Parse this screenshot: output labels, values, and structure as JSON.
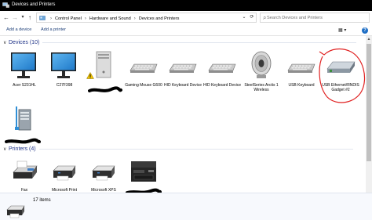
{
  "window": {
    "title": "Devices and Printers"
  },
  "address": {
    "crumbs": [
      "Control Panel",
      "Hardware and Sound",
      "Devices and Printers"
    ],
    "back_glyph": "←",
    "forward_glyph": "→",
    "recent_glyph": "▾",
    "up_glyph": "↑",
    "dropdown_glyph": "⌄",
    "refresh_glyph": "⟳",
    "search_placeholder": "Search Devices and Printers",
    "search_glyph": "⌕"
  },
  "commands": {
    "add_device": "Add a device",
    "add_printer": "Add a printer",
    "view_glyph": "▦ ▾",
    "help_glyph": "?"
  },
  "devices_section": {
    "label": "Devices (10)",
    "chevron": "∨",
    "items": [
      {
        "icon": "monitor-icon",
        "name": "Acer S231HL"
      },
      {
        "icon": "monitor-icon",
        "name": "C27F398"
      },
      {
        "icon": "computer-tower-icon",
        "name": "",
        "warning": true
      },
      {
        "icon": "keyboard-icon",
        "name": "Gaming Mouse G600"
      },
      {
        "icon": "keyboard-icon",
        "name": "HID Keyboard Device"
      },
      {
        "icon": "keyboard-icon",
        "name": "HID Keyboard Device"
      },
      {
        "icon": "speaker-icon",
        "name": "SteelSeries Arctis 1 Wireless"
      },
      {
        "icon": "keyboard-icon",
        "name": "USB Keyboard"
      },
      {
        "icon": "network-adapter-icon",
        "name": "USB Ethernet/RNDIS Gadget #2",
        "circled": true
      },
      {
        "icon": "network-server-icon",
        "name": ""
      }
    ]
  },
  "printers_section": {
    "label": "Printers (4)",
    "chevron": "∨",
    "items": [
      {
        "icon": "fax-icon",
        "name": "Fax"
      },
      {
        "icon": "printer-icon",
        "name": "Microsoft Print"
      },
      {
        "icon": "printer-icon",
        "name": "Microsoft XPS"
      },
      {
        "icon": "multifunction-printer-icon",
        "name": ""
      }
    ]
  },
  "details": {
    "count": "17 items"
  },
  "colors": {
    "titlebar": "#000000",
    "section_label": "#1e3287",
    "annotation": "#e02020",
    "link": "#1c3e78"
  }
}
